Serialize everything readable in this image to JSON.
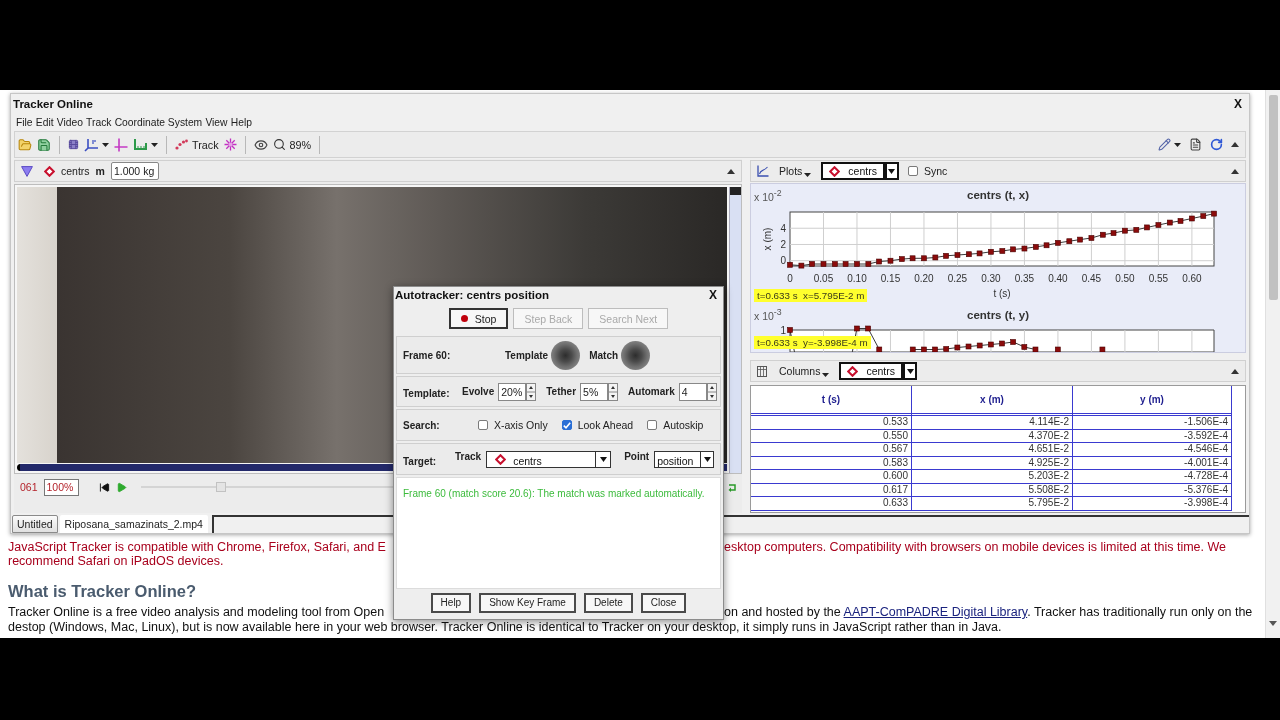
{
  "window": {
    "title": "Tracker Online",
    "close": "X"
  },
  "menu": [
    "File",
    "Edit",
    "Video",
    "Track",
    "Coordinate System",
    "View",
    "Help"
  ],
  "toolbar": {
    "track_button": "Track",
    "zoom": "89%"
  },
  "track_bar": {
    "track": "centrs",
    "mass_label": "m",
    "mass": "1.000 kg"
  },
  "plots": {
    "menu": "Plots",
    "track": "centrs",
    "sync": {
      "label": "Sync",
      "checked": false
    },
    "charts": [
      {
        "kind": "data",
        "scale": "x 10$^{-2}$",
        "readout": "t=0.633 s  x=5.795E-2 m",
        "chart_data": {
          "type": "line",
          "title": "centrs (t, x)",
          "xlabel": "t (s)",
          "ylabel": "x (m)",
          "grid": true,
          "marker": "square",
          "x": [
            0,
            0.017,
            0.033,
            0.05,
            0.067,
            0.083,
            0.1,
            0.117,
            0.133,
            0.15,
            0.167,
            0.183,
            0.2,
            0.217,
            0.233,
            0.25,
            0.267,
            0.283,
            0.3,
            0.317,
            0.333,
            0.35,
            0.367,
            0.383,
            0.4,
            0.417,
            0.433,
            0.45,
            0.467,
            0.483,
            0.5,
            0.517,
            0.533,
            0.55,
            0.567,
            0.583,
            0.6,
            0.617,
            0.633
          ],
          "values": [
            -0.5,
            -0.6,
            -0.4,
            -0.4,
            -0.4,
            -0.4,
            -0.4,
            -0.4,
            -0.1,
            0,
            0.2,
            0.3,
            0.3,
            0.4,
            0.6,
            0.7,
            0.8,
            0.9,
            1.1,
            1.2,
            1.4,
            1.5,
            1.7,
            1.9,
            2.2,
            2.4,
            2.6,
            2.8,
            3.2,
            3.4,
            3.7,
            3.8,
            4.1,
            4.4,
            4.7,
            4.9,
            5.2,
            5.5,
            5.8
          ],
          "xlim": [
            0,
            0.633
          ],
          "ylim": [
            -0.65,
            6
          ],
          "xticks": [
            {
              "value": 0,
              "label": "0"
            },
            {
              "value": 0.05,
              "label": "0.05"
            },
            {
              "value": 0.1,
              "label": "0.10"
            },
            {
              "value": 0.15,
              "label": "0.15"
            },
            {
              "value": 0.2,
              "label": "0.20"
            },
            {
              "value": 0.25,
              "label": "0.25"
            },
            {
              "value": 0.3,
              "label": "0.30"
            },
            {
              "value": 0.35,
              "label": "0.35"
            },
            {
              "value": 0.4,
              "label": "0.40"
            },
            {
              "value": 0.45,
              "label": "0.45"
            },
            {
              "value": 0.5,
              "label": "0.50"
            },
            {
              "value": 0.55,
              "label": "0.55"
            },
            {
              "value": 0.6,
              "label": "0.60"
            }
          ],
          "yticks": [
            0,
            2,
            4
          ]
        }
      },
      {
        "kind": "picture",
        "title": "centrs (t, y)",
        "scale": "x 10$^{-3}$",
        "tick": "1",
        "readout": "t=0.633 s  y=-3.998E-4 m"
      }
    ]
  },
  "player": {
    "frame": "061",
    "rate": "100%",
    "level": 0.14
  },
  "table": {
    "menu": "Columns",
    "track": "centrs",
    "columns": [
      "t (s)",
      "x (m)",
      "y (m)"
    ],
    "rows": [
      [
        "0.533",
        "4.114E-2",
        "-1.506E-4"
      ],
      [
        "0.550",
        "4.370E-2",
        "-3.592E-4"
      ],
      [
        "0.567",
        "4.651E-2",
        "-4.546E-4"
      ],
      [
        "0.583",
        "4.925E-2",
        "-4.001E-4"
      ],
      [
        "0.600",
        "5.203E-2",
        "-4.728E-4"
      ],
      [
        "0.617",
        "5.508E-2",
        "-5.376E-4"
      ],
      [
        "0.633",
        "5.795E-2",
        "-3.998E-4"
      ]
    ]
  },
  "video_tabs": [
    {
      "label": "Untitled",
      "selected": false
    },
    {
      "label": "Riposana_samazinats_2.mp4",
      "selected": true
    }
  ],
  "autotracker": {
    "title": "Autotracker: centrs position",
    "close": "X",
    "buttons": {
      "stop": {
        "label": "Stop",
        "disabled": false
      },
      "step_back": {
        "label": "Step Back",
        "disabled": true
      },
      "search_next": {
        "label": "Search Next",
        "disabled": true
      }
    },
    "frame": {
      "label": "Frame 60:",
      "template": "Template",
      "match": "Match"
    },
    "template": {
      "label": "Template:",
      "spinners": [
        {
          "label": "Evolve",
          "value": "20%"
        },
        {
          "label": "Tether",
          "value": "5%"
        },
        {
          "label": "Automark",
          "value": "4"
        }
      ]
    },
    "search": {
      "label": "Search:",
      "options": [
        {
          "label": "X-axis Only",
          "checked": false
        },
        {
          "label": "Look Ahead",
          "checked": true
        },
        {
          "label": "Autoskip",
          "checked": false
        }
      ]
    },
    "target": {
      "label": "Target:",
      "track_label": "Track",
      "track": "centrs",
      "point_label": "Point",
      "point": "position"
    },
    "message": "Frame 60 (match score 20.6): The match was marked automatically.",
    "footer_buttons": {
      "help": "Help",
      "show_key_frame": "Show Key Frame",
      "delete": "Delete",
      "close": "Close"
    }
  },
  "page": {
    "notice": [
      {
        "left": "JavaScript Tracker is compatible with Chrome, Firefox, Safari, and E",
        "right": "esktop computers. Compatibility with browsers on mobile devices is limited at this time. We"
      },
      {
        "left": "recommend Safari on iPadOS devices."
      }
    ],
    "heading": "What is Tracker Online?",
    "intro": [
      {
        "left": "Tracker Online is a free video analysis and modeling tool from Open",
        "right": "on and hosted by the ",
        "link": "AAPT-ComPADRE Digital Library",
        "right_end": ". Tracker has traditionally run only on the"
      },
      {
        "full": "destop (Windows, Mac, Linux), but is now available here in your web browser. Tracker Online is identical to Tracker on your desktop, it simply runs in JavaScript rather than in Java."
      }
    ]
  }
}
